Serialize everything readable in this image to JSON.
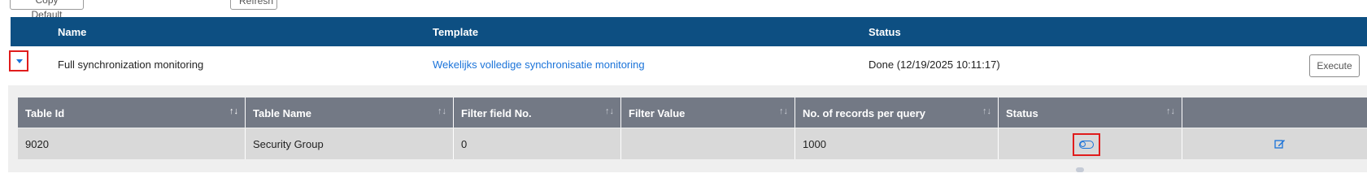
{
  "toolbar": {
    "copy_default_label": "Copy Default",
    "refresh_label": "Refresh"
  },
  "outer_table": {
    "headers": {
      "name": "Name",
      "template": "Template",
      "status": "Status"
    },
    "row": {
      "name": "Full synchronization monitoring",
      "template": "Wekelijks volledige synchronisatie monitoring",
      "status": "Done (12/19/2025 10:11:17)",
      "execute_label": "Execute"
    }
  },
  "inner_table": {
    "headers": [
      {
        "label": "Table Id"
      },
      {
        "label": "Table Name"
      },
      {
        "label": "Filter field No."
      },
      {
        "label": "Filter Value"
      },
      {
        "label": "No. of records per query"
      },
      {
        "label": "Status"
      },
      {
        "label": ""
      }
    ],
    "row": {
      "table_id": "9020",
      "table_name": "Security Group",
      "filter_field_no": "0",
      "filter_value": "",
      "records_per_query": "1000"
    }
  },
  "icons": {
    "expand": "caret-down-icon",
    "sort": "sort-icon",
    "status": "toggle-icon",
    "edit": "edit-icon"
  },
  "colors": {
    "header_bg": "#0d4f82",
    "inner_header_bg": "#737985",
    "link": "#1a73d9",
    "highlight": "#e01c1c"
  }
}
